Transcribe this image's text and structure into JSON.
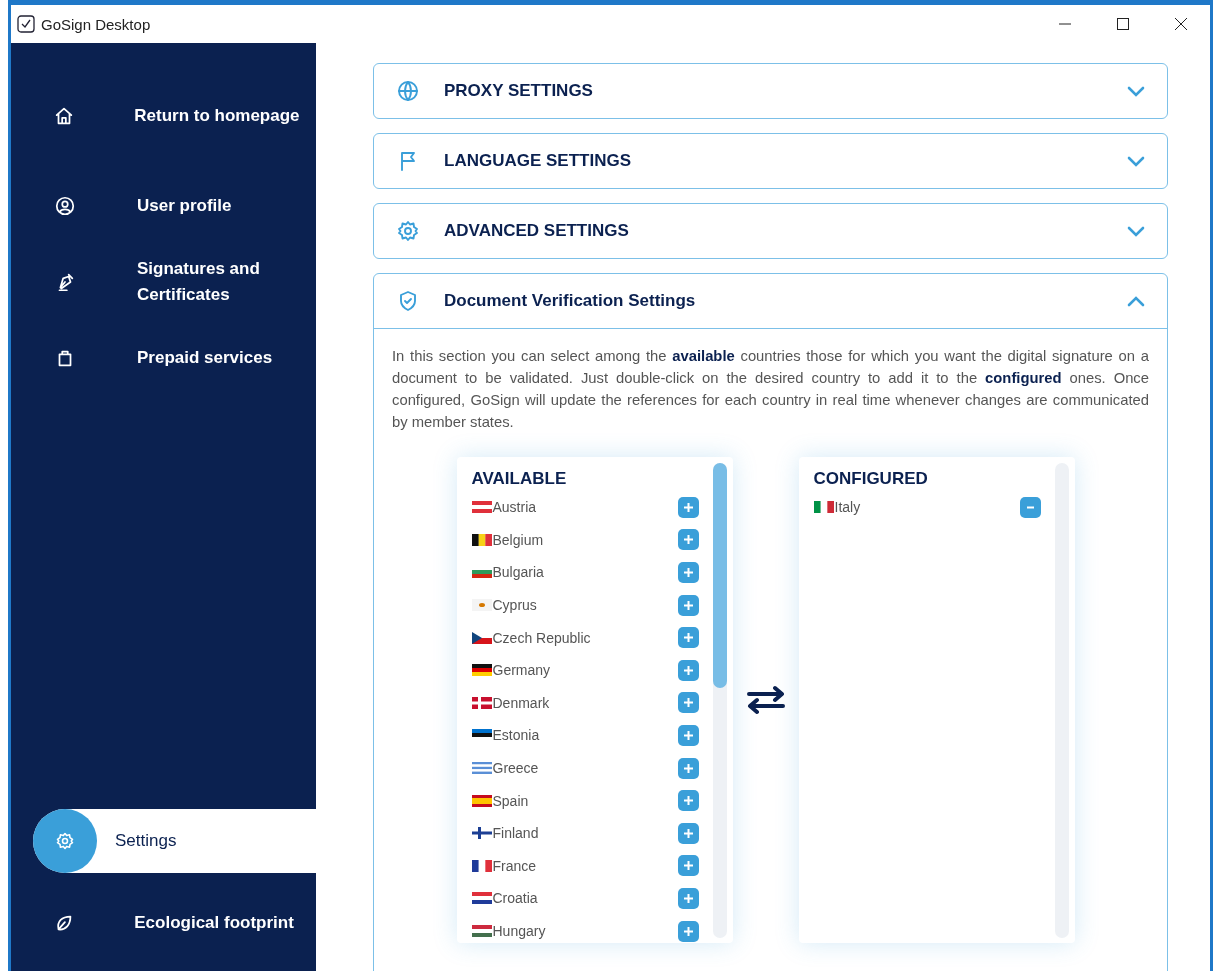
{
  "window": {
    "title": "GoSign Desktop"
  },
  "sidebar": {
    "items": [
      {
        "label": "Return to homepage",
        "selected": false
      },
      {
        "label": "User profile",
        "selected": false
      },
      {
        "label": "Signatures and Certificates",
        "selected": false
      },
      {
        "label": "Prepaid services",
        "selected": false
      },
      {
        "label": "Settings",
        "selected": true
      },
      {
        "label": "Ecological footprint",
        "selected": false
      }
    ]
  },
  "sections": [
    {
      "title": "PROXY SETTINGS",
      "expanded": false
    },
    {
      "title": "LANGUAGE SETTINGS",
      "expanded": false
    },
    {
      "title": "ADVANCED SETTINGS",
      "expanded": false
    },
    {
      "title": "Document Verification Settings",
      "expanded": true,
      "description": "In this section you can select among the **available** countries those for which you want the digital signature on a document to be validated. Just double-click on the desired country to add it to the **configured** ones. Once configured, GoSign will update the references for each country in real time whenever changes are communicated by member states.",
      "available": {
        "title": "AVAILABLE",
        "items": [
          {
            "name": "Austria"
          },
          {
            "name": "Belgium"
          },
          {
            "name": "Bulgaria"
          },
          {
            "name": "Cyprus"
          },
          {
            "name": "Czech Republic"
          },
          {
            "name": "Germany"
          },
          {
            "name": "Denmark"
          },
          {
            "name": "Estonia"
          },
          {
            "name": "Greece"
          },
          {
            "name": "Spain"
          },
          {
            "name": "Finland"
          },
          {
            "name": "France"
          },
          {
            "name": "Croatia"
          },
          {
            "name": "Hungary"
          }
        ]
      },
      "configured": {
        "title": "CONFIGURED",
        "items": [
          {
            "name": "Italy"
          }
        ]
      }
    }
  ]
}
